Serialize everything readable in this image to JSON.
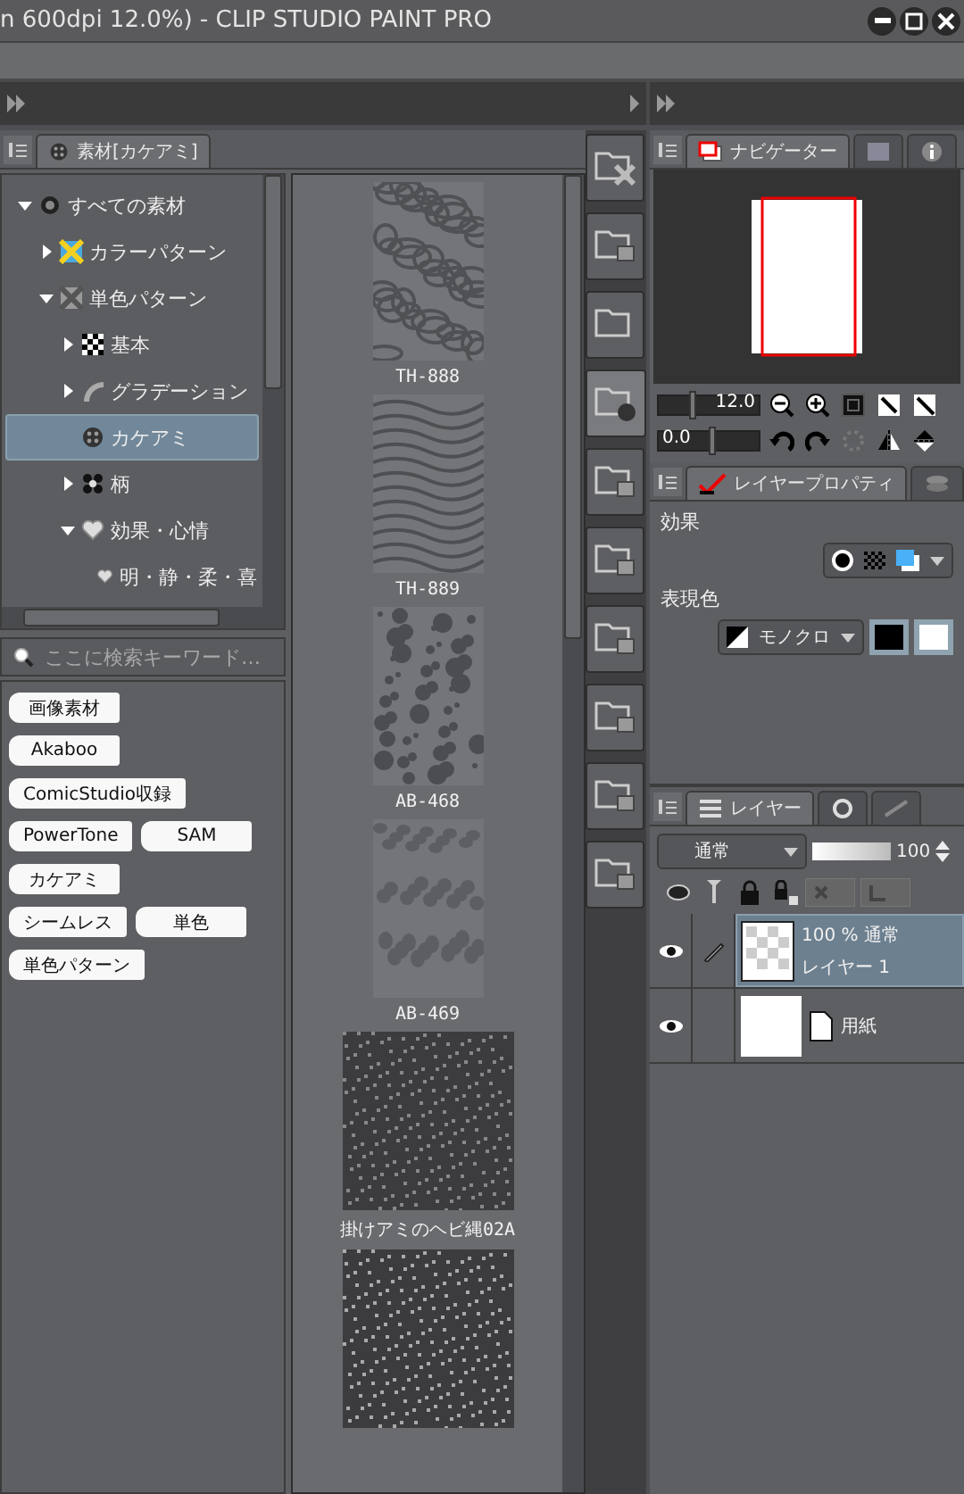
{
  "window": {
    "title": "n 600dpi 12.0%)  - CLIP STUDIO PAINT PRO",
    "controls": [
      {
        "kind": "minimize"
      },
      {
        "kind": "maximize"
      },
      {
        "kind": "close"
      }
    ]
  },
  "material_panel": {
    "tab": "素材[カケアミ]",
    "tree": [
      {
        "label": "すべての素材",
        "kind": "branch",
        "expanded": true,
        "selected": false,
        "children": [
          {
            "label": "カラーパターン",
            "kind": "branch",
            "expanded": false,
            "selected": false
          },
          {
            "label": "単色パターン",
            "kind": "branch",
            "expanded": true,
            "selected": false,
            "children": [
              {
                "label": "基本",
                "kind": "branch",
                "expanded": false,
                "selected": false
              },
              {
                "label": "グラデーション",
                "kind": "branch",
                "expanded": false,
                "selected": false
              },
              {
                "label": "カケアミ",
                "kind": "leaf",
                "selected": true
              },
              {
                "label": "柄",
                "kind": "branch",
                "expanded": false,
                "selected": false
              },
              {
                "label": "効果・心情",
                "kind": "branch",
                "expanded": true,
                "selected": false,
                "children": [
                  {
                    "label": "明・静・柔・喜",
                    "kind": "leaf",
                    "selected": false
                  }
                ]
              }
            ]
          }
        ]
      }
    ],
    "search": {
      "placeholder": "ここに検索キーワード…"
    },
    "tag_rows": [
      [
        "画像素材"
      ],
      [
        "Akaboo"
      ],
      [
        "ComicStudio収録"
      ],
      [
        "PowerTone",
        "SAM"
      ],
      [
        "カケアミ"
      ],
      [
        "シームレス",
        "単色"
      ],
      [
        "単色パターン"
      ]
    ],
    "materials": [
      {
        "name": "TH-888",
        "kind": "cells"
      },
      {
        "name": "TH-889",
        "kind": "waves"
      },
      {
        "name": "AB-468",
        "kind": "dots"
      },
      {
        "name": "AB-469",
        "kind": "blobs"
      },
      {
        "name": "掛けアミのヘビ縄02A",
        "kind": "noise"
      },
      {
        "kind": "rope"
      }
    ]
  },
  "folder_buttons": [
    {
      "selected": false
    },
    {
      "selected": false
    },
    {
      "selected": false
    },
    {
      "selected": true
    },
    {
      "selected": false
    },
    {
      "selected": false
    },
    {
      "selected": false
    },
    {
      "selected": false
    },
    {
      "selected": false
    },
    {
      "selected": false
    }
  ],
  "navigator": {
    "tabs": [
      {
        "label": "ナビゲーター",
        "selected": true
      },
      {
        "selected": false
      },
      {
        "selected": false
      }
    ],
    "zoom": {
      "reading": "12.0",
      "level": 0.3
    },
    "rotation": {
      "reading": "0.0",
      "level": 0.5
    }
  },
  "layer_property": {
    "tabs": [
      {
        "label": "レイヤープロパティ",
        "selected": true
      },
      {
        "selected": false
      }
    ],
    "effect_label": "効果",
    "color_label": "表現色",
    "color_mode": "モノクロ"
  },
  "layers": {
    "tabs": [
      {
        "label": "レイヤー",
        "selected": true
      },
      {
        "selected": false
      },
      {
        "selected": false
      }
    ],
    "blend_mode": "通常",
    "opacity": "100",
    "items": [
      {
        "kind": "raster",
        "mode": "100 % 通常",
        "name": "レイヤー 1",
        "selected": true,
        "visible": true
      },
      {
        "kind": "paper",
        "name": "用紙",
        "selected": false,
        "visible": true
      }
    ]
  }
}
